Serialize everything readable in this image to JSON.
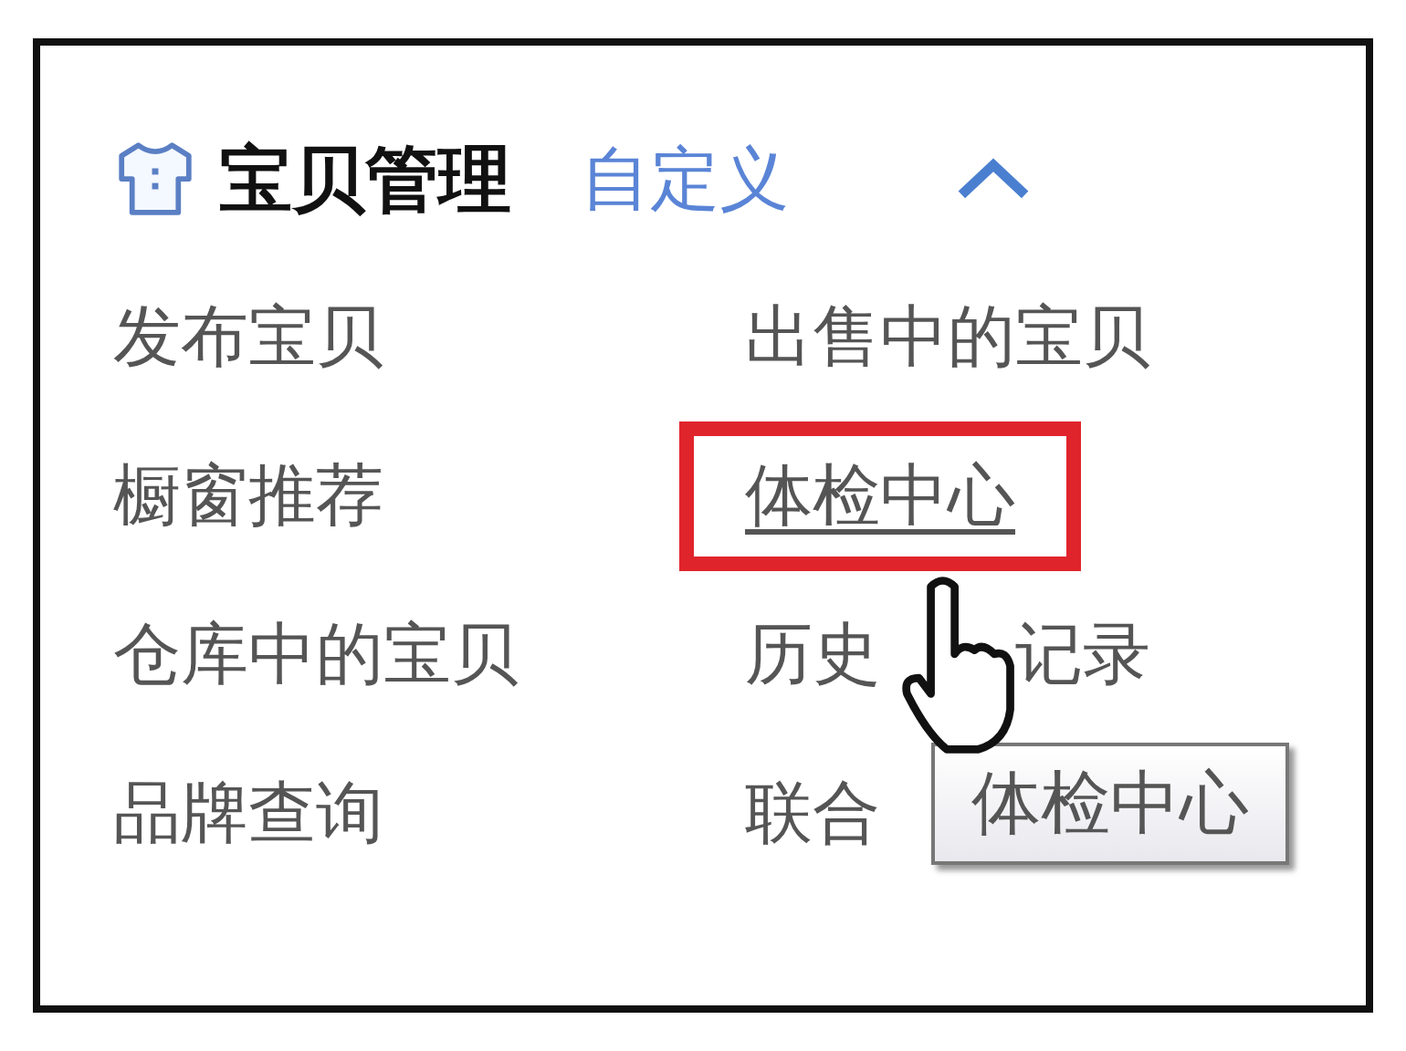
{
  "header": {
    "title": "宝贝管理",
    "link": "自定义",
    "expanded": true
  },
  "items": [
    {
      "label": "发布宝贝",
      "highlighted": false
    },
    {
      "label": "出售中的宝贝",
      "highlighted": false
    },
    {
      "label": "橱窗推荐",
      "highlighted": false
    },
    {
      "label": "体检中心",
      "highlighted": true
    },
    {
      "label": "仓库中的宝贝",
      "highlighted": false
    },
    {
      "segments": [
        "历史",
        "记录"
      ],
      "highlighted": false
    },
    {
      "label": "品牌查询",
      "highlighted": false
    },
    {
      "segments": [
        "联合"
      ],
      "highlighted": false
    }
  ],
  "tooltip": "体检中心"
}
